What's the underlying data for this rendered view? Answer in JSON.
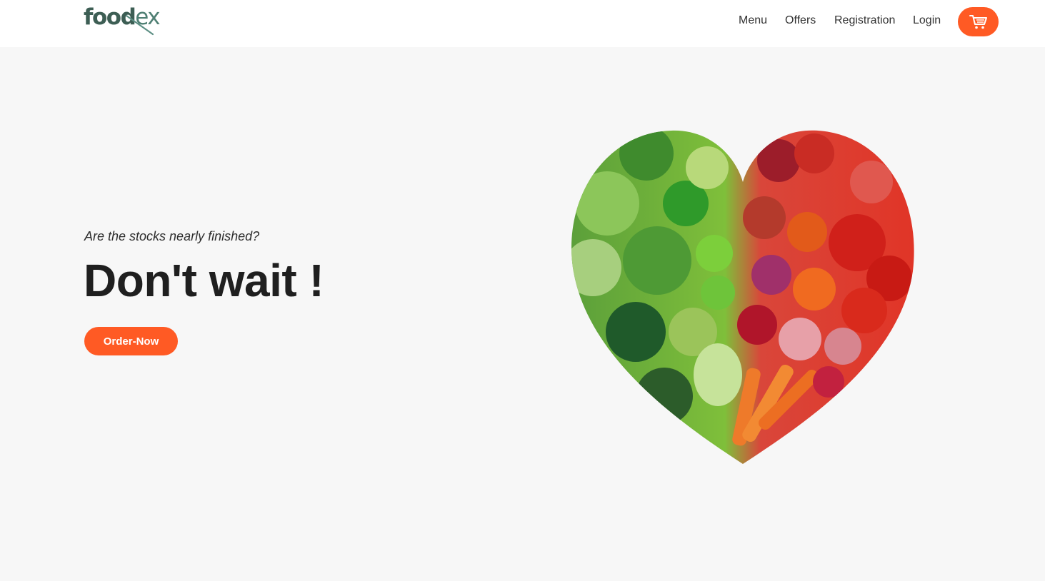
{
  "brand": {
    "name_main": "food",
    "name_accent": "ex"
  },
  "nav": {
    "items": [
      {
        "label": "Menu"
      },
      {
        "label": "Offers"
      },
      {
        "label": "Registration"
      },
      {
        "label": "Login"
      }
    ],
    "cart_icon": "shopping-cart-icon"
  },
  "hero": {
    "subtitle": "Are the stocks nearly finished?",
    "title": "Don't wait !",
    "cta_label": "Order-Now",
    "image_icon": "vegetable-heart-image"
  },
  "colors": {
    "accent": "#ff5a24",
    "brand": "#3d5e54",
    "background": "#f7f7f7",
    "header": "#ffffff"
  }
}
